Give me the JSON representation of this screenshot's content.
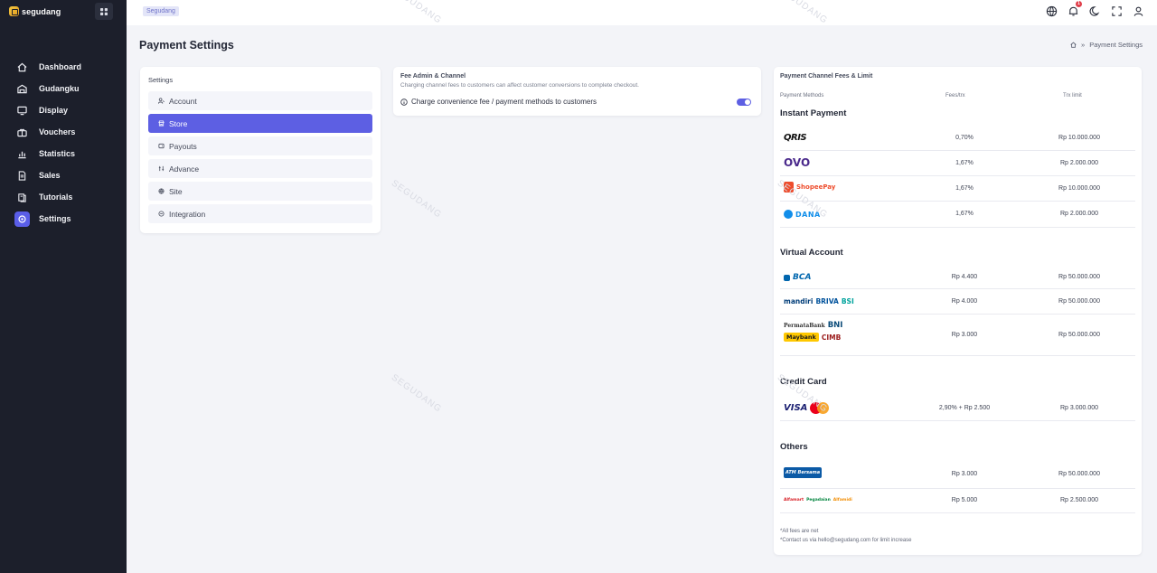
{
  "brand": {
    "name": "segudang",
    "icon": "segudang-logo-icon"
  },
  "sidebar": {
    "items": [
      {
        "label": "Dashboard",
        "icon": "home-icon"
      },
      {
        "label": "Gudangku",
        "icon": "warehouse-icon"
      },
      {
        "label": "Display",
        "icon": "monitor-icon"
      },
      {
        "label": "Vouchers",
        "icon": "voucher-icon"
      },
      {
        "label": "Statistics",
        "icon": "chart-icon"
      },
      {
        "label": "Sales",
        "icon": "document-icon"
      },
      {
        "label": "Tutorials",
        "icon": "book-icon"
      },
      {
        "label": "Settings",
        "icon": "settings-icon",
        "active": true
      }
    ]
  },
  "topbar": {
    "badge": "Segudang",
    "icons": [
      "globe-icon",
      "bell-icon",
      "moon-icon",
      "fullscreen-icon",
      "user-icon"
    ],
    "notification_count": "1"
  },
  "page": {
    "title": "Payment Settings",
    "breadcrumb": {
      "current": "Payment Settings"
    }
  },
  "settings": {
    "title": "Settings",
    "items": [
      {
        "label": "Account",
        "icon": "user-key-icon"
      },
      {
        "label": "Store",
        "icon": "store-icon",
        "active": true
      },
      {
        "label": "Payouts",
        "icon": "wallet-icon"
      },
      {
        "label": "Advance",
        "icon": "sliders-icon"
      },
      {
        "label": "Site",
        "icon": "globe-icon"
      },
      {
        "label": "Integration",
        "icon": "plug-icon"
      }
    ]
  },
  "fee_admin": {
    "title": "Fee Admin & Channel",
    "subtitle": "Charging channel fees to customers can affect customer conversions to complete checkout.",
    "toggle_label": "Charge convenience fee / payment methods to customers",
    "toggle_on": true
  },
  "payment_channels": {
    "title": "Payment Channel Fees & Limit",
    "columns": {
      "method": "Payment Methods",
      "fees": "Fees/trx",
      "limit": "Trx limit"
    },
    "sections": [
      {
        "name": "Instant Payment",
        "rows": [
          {
            "logos": [
              "QRIS"
            ],
            "fee": "0,70%",
            "limit": "Rp 10.000.000"
          },
          {
            "logos": [
              "OVO"
            ],
            "fee": "1,67%",
            "limit": "Rp 2.000.000"
          },
          {
            "logos": [
              "ShopeePay"
            ],
            "fee": "1,67%",
            "limit": "Rp 10.000.000"
          },
          {
            "logos": [
              "DANA"
            ],
            "fee": "1,67%",
            "limit": "Rp 2.000.000"
          }
        ]
      },
      {
        "name": "Virtual Account",
        "rows": [
          {
            "logos": [
              "BCA"
            ],
            "fee": "Rp 4.400",
            "limit": "Rp 50.000.000"
          },
          {
            "logos": [
              "mandiri",
              "BRIVA",
              "BSI"
            ],
            "fee": "Rp 4.000",
            "limit": "Rp 50.000.000"
          },
          {
            "logos": [
              "PermataBank",
              "BNI",
              "Maybank",
              "CIMB"
            ],
            "fee": "Rp 3.000",
            "limit": "Rp 50.000.000"
          }
        ]
      },
      {
        "name": "Credit Card",
        "rows": [
          {
            "logos": [
              "VISA",
              "Mastercard"
            ],
            "fee": "2,90% + Rp 2.500",
            "limit": "Rp 3.000.000"
          }
        ]
      },
      {
        "name": "Others",
        "rows": [
          {
            "logos": [
              "ATM Bersama"
            ],
            "fee": "Rp 3.000",
            "limit": "Rp 50.000.000"
          },
          {
            "logos": [
              "Alfamart",
              "Pegadaian",
              "Alfamidi"
            ],
            "fee": "Rp 5.000",
            "limit": "Rp 2.500.000"
          }
        ]
      }
    ],
    "footnotes": [
      "*All fees are net",
      "*Contact us via hello@segudang.com for limit increase"
    ]
  },
  "watermark": "SEGUDANG",
  "colors": {
    "sidebar_bg": "#1c1f2b",
    "accent": "#5d5fe3",
    "page_bg": "#f3f4f8"
  }
}
